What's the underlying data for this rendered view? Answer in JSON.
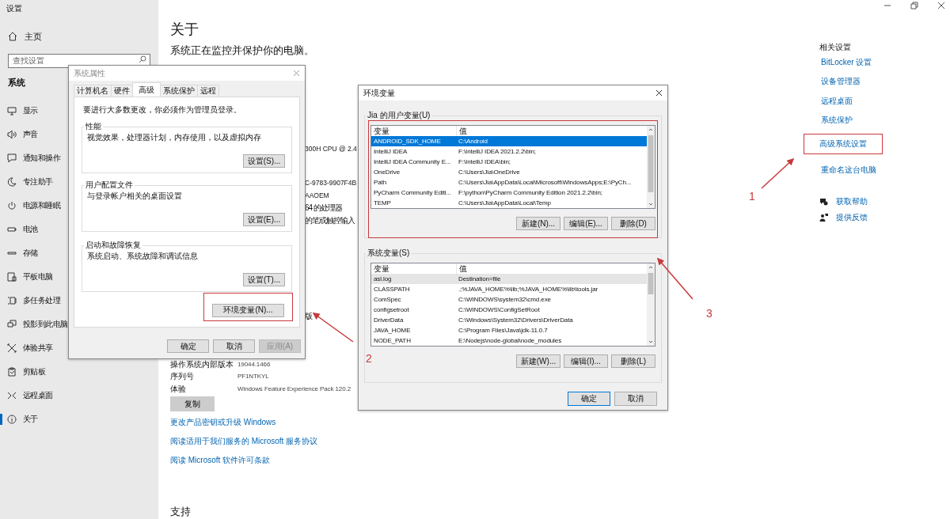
{
  "window": {
    "title": "设置"
  },
  "sidebar": {
    "home": "主页",
    "search": {
      "placeholder": "查找设置"
    },
    "section": "系统",
    "items": [
      {
        "label": "显示",
        "selected": false
      },
      {
        "label": "声音",
        "selected": false
      },
      {
        "label": "通知和操作",
        "selected": false
      },
      {
        "label": "专注助手",
        "selected": false
      },
      {
        "label": "电源和睡眠",
        "selected": false
      },
      {
        "label": "电池",
        "selected": false
      },
      {
        "label": "存储",
        "selected": false
      },
      {
        "label": "平板电脑",
        "selected": false
      },
      {
        "label": "多任务处理",
        "selected": false
      },
      {
        "label": "投影到此电脑",
        "selected": false
      },
      {
        "label": "体验共享",
        "selected": false
      },
      {
        "label": "剪贴板",
        "selected": false
      },
      {
        "label": "远程桌面",
        "selected": false
      },
      {
        "label": "关于",
        "selected": true
      }
    ]
  },
  "main": {
    "title": "关于",
    "subtitle": "系统正在监控并保护你的电脑。",
    "spec_fragments": [
      "300H CPU @ 2.4",
      "C-9783-9907F4B",
      "AAOEM",
      "64 的处理器",
      "的笔或触控输入"
    ],
    "edition_fragment": "版",
    "spec_rows": [
      {
        "label": "操作系统内部版本",
        "value": "19044.1466"
      },
      {
        "label": "序列号",
        "value": "PF1NTKYL"
      },
      {
        "label": "体验",
        "value": "Windows Feature Experience Pack 120.2"
      }
    ],
    "copy_button": "复制",
    "links": [
      "更改产品密钥或升级 Windows",
      "阅读适用于我们服务的 Microsoft 服务协议",
      "阅读 Microsoft 软件许可条款"
    ],
    "support_heading": "支持"
  },
  "related": {
    "heading": "相关设置",
    "links": [
      {
        "label": "BitLocker 设置",
        "highlighted": false
      },
      {
        "label": "设备管理器",
        "highlighted": false
      },
      {
        "label": "远程桌面",
        "highlighted": false
      },
      {
        "label": "系统保护",
        "highlighted": false
      },
      {
        "label": "高级系统设置",
        "highlighted": true
      },
      {
        "label": "重命名这台电脑",
        "highlighted": false
      }
    ],
    "help": [
      "获取帮助",
      "提供反馈"
    ]
  },
  "system_properties": {
    "title": "系统属性",
    "tabs": [
      {
        "label": "计算机名",
        "selected": false
      },
      {
        "label": "硬件",
        "selected": false
      },
      {
        "label": "高级",
        "selected": true
      },
      {
        "label": "系统保护",
        "selected": false
      },
      {
        "label": "远程",
        "selected": false
      }
    ],
    "note": "要进行大多数更改，你必须作为管理员登录。",
    "groups": [
      {
        "title": "性能",
        "description": "视觉效果，处理器计划，内存使用，以及虚拟内存",
        "button": "设置(S)..."
      },
      {
        "title": "用户配置文件",
        "description": "与登录帐户相关的桌面设置",
        "button": "设置(E)..."
      },
      {
        "title": "启动和故障恢复",
        "description": "系统启动、系统故障和调试信息",
        "button": "设置(T)..."
      }
    ],
    "env_button": {
      "label": "环境变量(N)...",
      "highlighted": true
    },
    "buttons": [
      {
        "label": "确定",
        "disabled": false
      },
      {
        "label": "取消",
        "disabled": false
      },
      {
        "label": "应用(A)",
        "disabled": true
      }
    ]
  },
  "environment_variables": {
    "title": "环境变量",
    "groups": [
      {
        "title": "Jia 的用户变量(U)",
        "highlighted": true,
        "focused": true,
        "columns": [
          "变量",
          "值"
        ],
        "rows": [
          {
            "name": "ANDROID_SDK_HOME",
            "value": "C:\\Android",
            "selected": true
          },
          {
            "name": "IntelliJ IDEA",
            "value": "F:\\IntelliJ IDEA 2021.2.2\\bin;",
            "selected": false
          },
          {
            "name": "IntelliJ IDEA Community E...",
            "value": "F:\\IntelliJ IDEA\\bin;",
            "selected": false
          },
          {
            "name": "OneDrive",
            "value": "C:\\Users\\Jia\\OneDrive",
            "selected": false
          },
          {
            "name": "Path",
            "value": "C:\\Users\\Jia\\AppData\\Local\\Microsoft\\WindowsApps;E:\\PyCh...",
            "selected": false
          },
          {
            "name": "PyCharm Community Editi...",
            "value": "F:\\python\\PyCharm Community Edition 2021.2.2\\bin;",
            "selected": false
          },
          {
            "name": "TEMP",
            "value": "C:\\Users\\Jia\\AppData\\Local\\Temp",
            "selected": false
          }
        ],
        "buttons": [
          "新建(N)...",
          "编辑(E)...",
          "删除(D)"
        ]
      },
      {
        "title": "系统变量(S)",
        "highlighted": false,
        "focused": false,
        "columns": [
          "变量",
          "值"
        ],
        "rows": [
          {
            "name": "asl.log",
            "value": "Destination=file",
            "selected": true
          },
          {
            "name": "CLASSPATH",
            "value": ".;%JAVA_HOME%\\lib;%JAVA_HOME%\\lib\\tools.jar",
            "selected": false
          },
          {
            "name": "ComSpec",
            "value": "C:\\WINDOWS\\system32\\cmd.exe",
            "selected": false
          },
          {
            "name": "configsetroot",
            "value": "C:\\WINDOWS\\ConfigSetRoot",
            "selected": false
          },
          {
            "name": "DriverData",
            "value": "C:\\Windows\\System32\\Drivers\\DriverData",
            "selected": false
          },
          {
            "name": "JAVA_HOME",
            "value": "C:\\Program Files\\Java\\jdk-11.0.7",
            "selected": false
          },
          {
            "name": "NODE_PATH",
            "value": "E:\\Nodejs\\node-global\\node_modules",
            "selected": false
          }
        ],
        "buttons": [
          "新建(W)...",
          "编辑(I)...",
          "删除(L)"
        ]
      }
    ],
    "buttons": [
      {
        "label": "确定",
        "default": true
      },
      {
        "label": "取消",
        "default": false
      }
    ]
  },
  "annotations": {
    "numbers": [
      "1",
      "2",
      "3"
    ]
  }
}
